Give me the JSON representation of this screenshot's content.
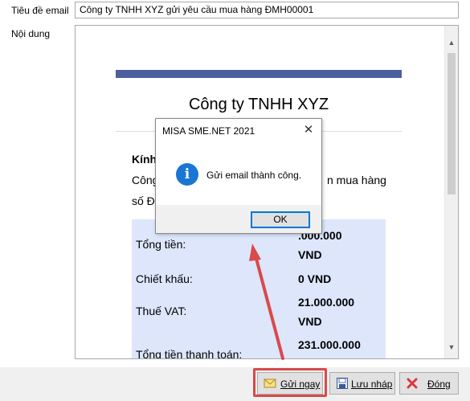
{
  "form": {
    "subject_label": "Tiêu đề email",
    "subject_value": "Công ty TNHH XYZ gửi yêu cầu mua hàng ĐMH00001",
    "body_label": "Nội dung"
  },
  "email_body": {
    "company": "Công ty TNHH XYZ",
    "greeting": "Kính",
    "line1": "Công",
    "line1_tail": "n mua hàng",
    "line2": "số Đ"
  },
  "summary": {
    "rows": [
      {
        "label": "Tổng tiền:",
        "value": ".000.000"
      },
      {
        "label": "",
        "value": "VND"
      },
      {
        "label": "Chiết khấu:",
        "value": "0 VND"
      },
      {
        "label": "",
        "value": "21.000.000"
      },
      {
        "label": "Thuế VAT:",
        "value": "VND"
      },
      {
        "label": "",
        "value": "231.000.000"
      },
      {
        "label": "Tổng tiền thanh toán:",
        "value": ""
      }
    ]
  },
  "dialog": {
    "title": "MISA SME.NET 2021",
    "close_glyph": "✕",
    "icon_glyph": "i",
    "message": "Gửi email thành công.",
    "ok_label": "OK"
  },
  "buttons": {
    "send_label": "Gửi ngay",
    "draft_label": "Lưu nháp",
    "close_label": "Đóng"
  },
  "icons": {
    "send": "envelope-icon",
    "draft": "save-disk-icon",
    "close": "red-x-icon",
    "info": "info-icon"
  },
  "colors": {
    "accent_bar": "#4b5e9e",
    "summary_bg": "#dde6fb",
    "annotation_red": "#d94a4a",
    "info_blue": "#1a76d2"
  }
}
